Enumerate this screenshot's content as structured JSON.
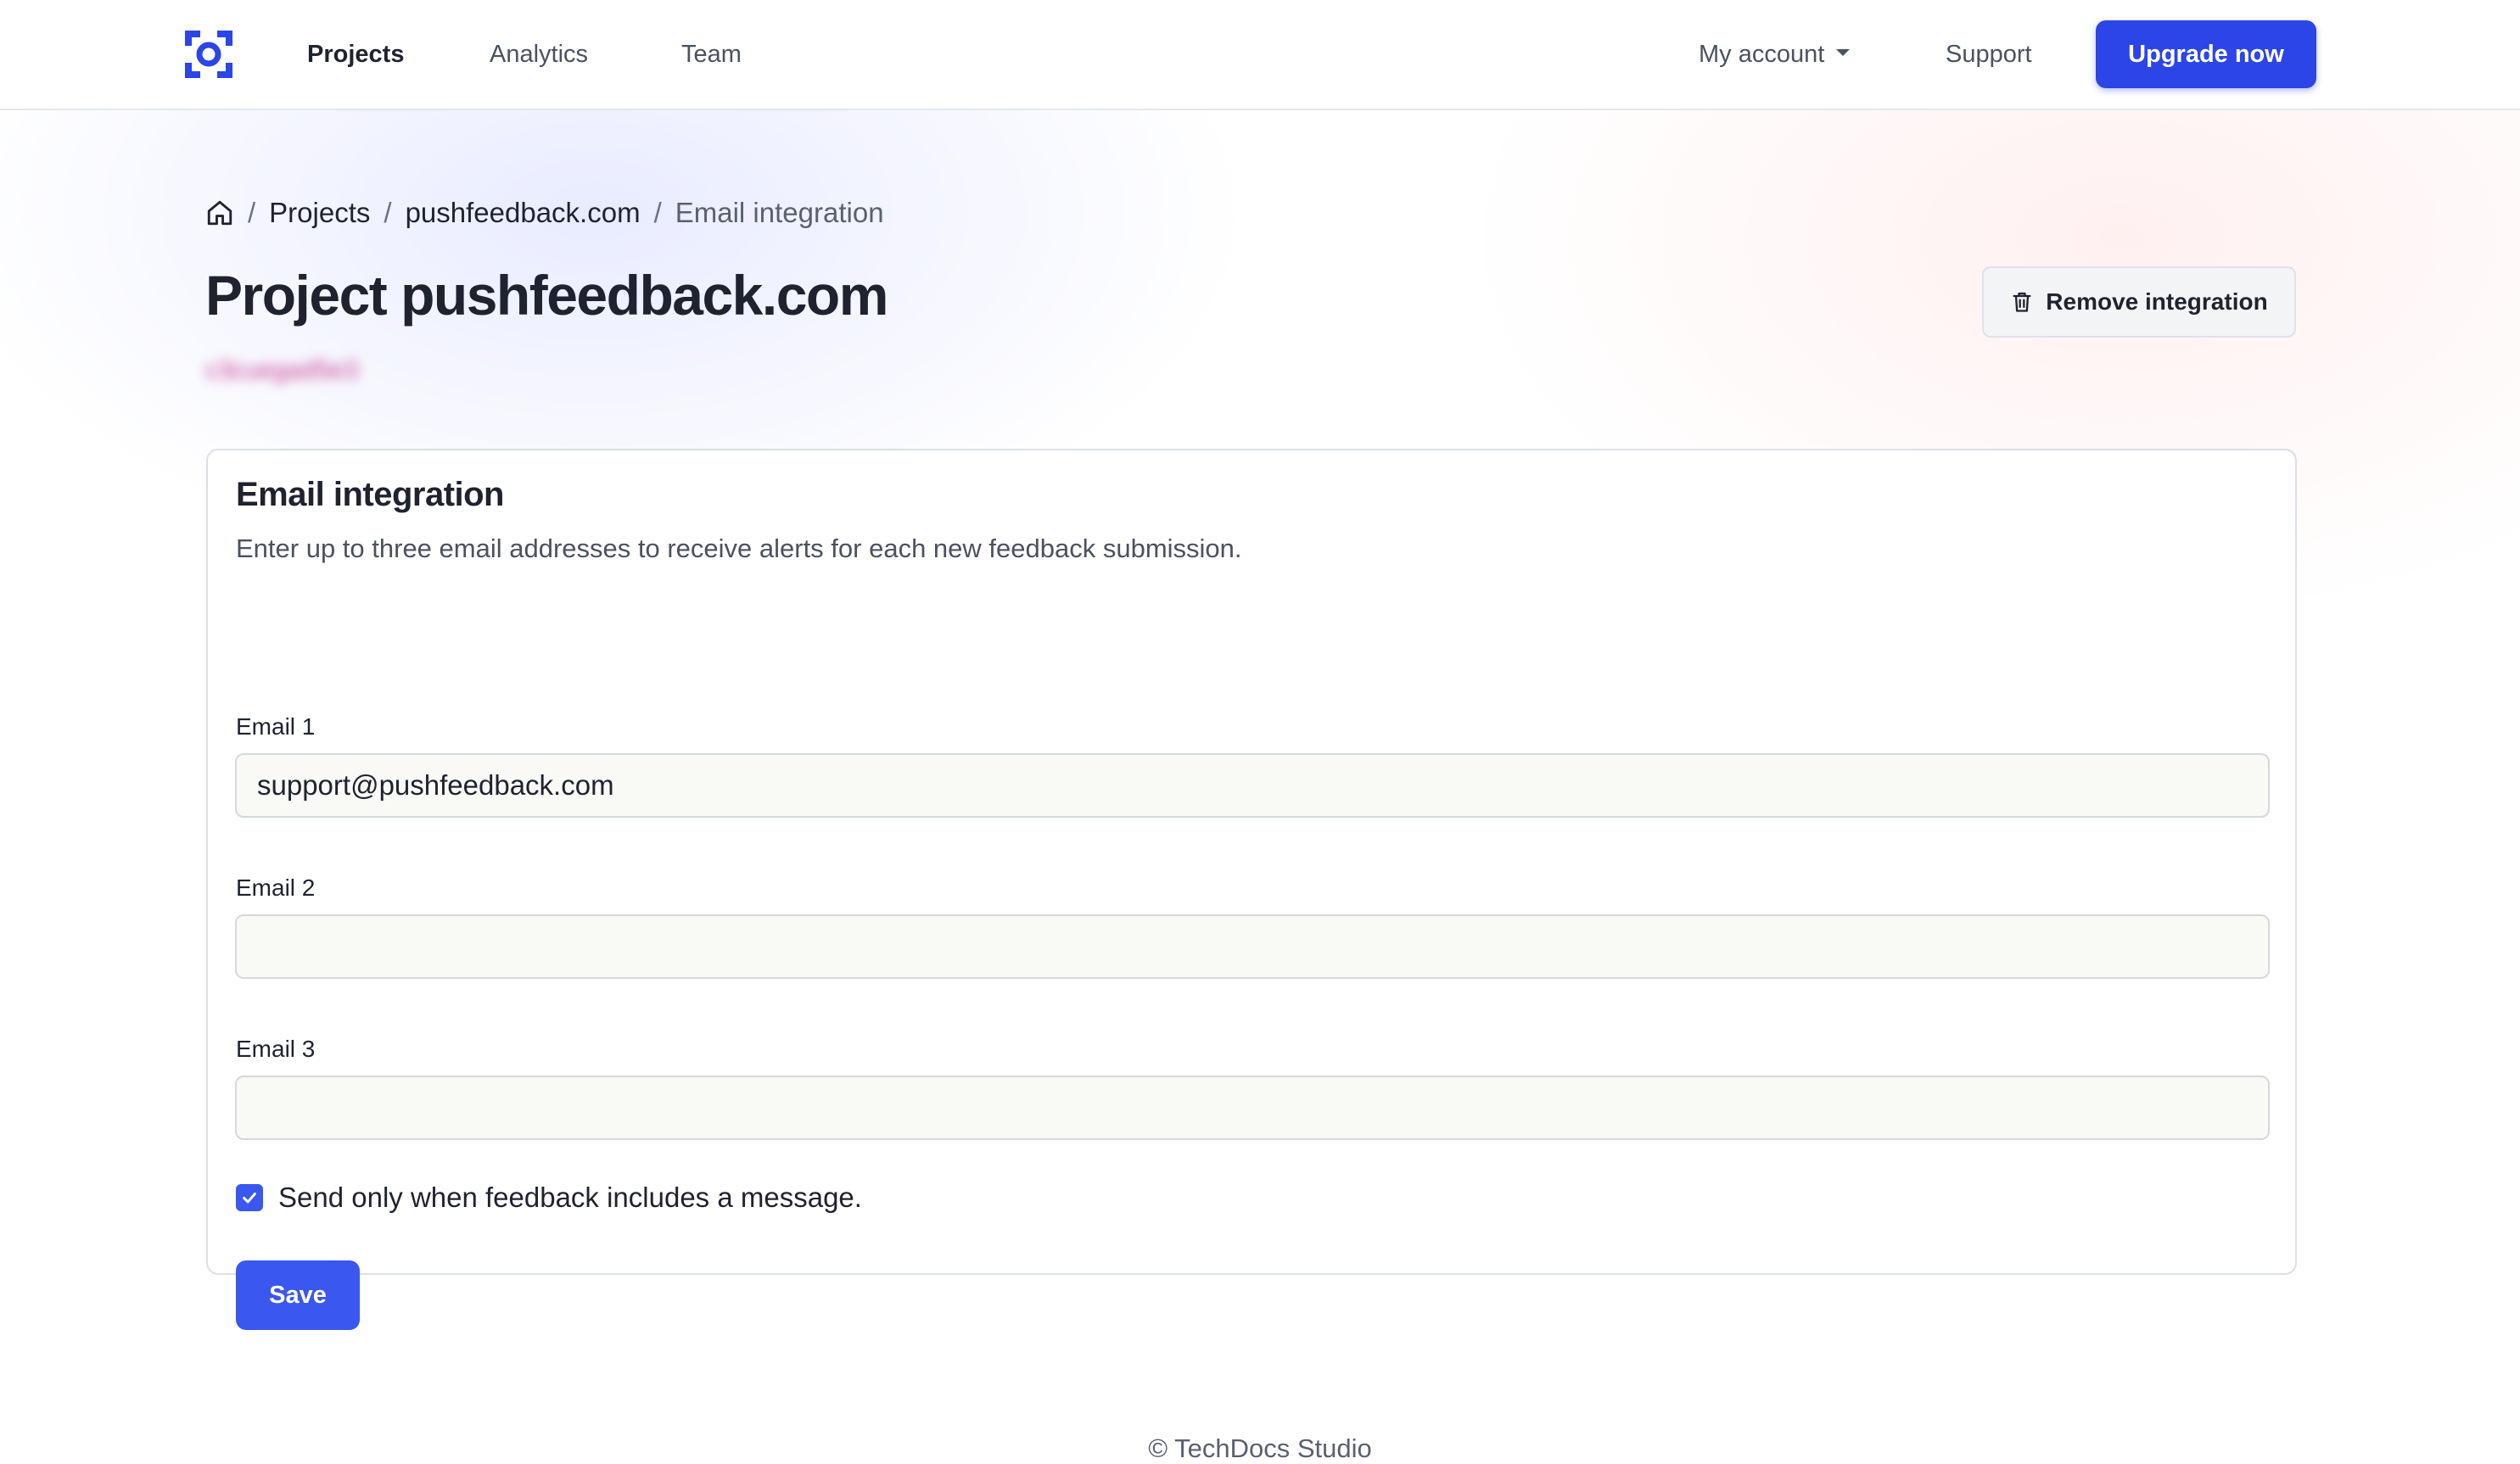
{
  "nav": {
    "logo_icon": "focus-camera-logo",
    "items": [
      {
        "label": "Projects",
        "active": true
      },
      {
        "label": "Analytics",
        "active": false
      },
      {
        "label": "Team",
        "active": false
      }
    ],
    "account_label": "My account",
    "support_label": "Support",
    "upgrade_label": "Upgrade now"
  },
  "breadcrumb": {
    "home_icon": "home-icon",
    "items": [
      "Projects",
      "pushfeedback.com"
    ],
    "current": "Email integration"
  },
  "page": {
    "title": "Project pushfeedback.com",
    "project_id": "c3cuegad5e3",
    "remove_label": "Remove integration",
    "remove_icon": "trash-icon"
  },
  "card": {
    "title": "Email integration",
    "description": "Enter up to three email addresses to receive alerts for each new feedback submission.",
    "fields": [
      {
        "label": "Email 1",
        "value": "support@pushfeedback.com"
      },
      {
        "label": "Email 2",
        "value": ""
      },
      {
        "label": "Email 3",
        "value": ""
      }
    ],
    "checkbox_label": "Send only when feedback includes a message.",
    "checkbox_checked": true,
    "save_label": "Save"
  },
  "footer": {
    "text": "© TechDocs Studio"
  },
  "colors": {
    "primary": "#2b45e6",
    "accent": "#3a57ef",
    "text": "#1f2330",
    "muted": "#4b5160",
    "input_bg": "#f9f9f5",
    "project_id": "#c8368a"
  }
}
